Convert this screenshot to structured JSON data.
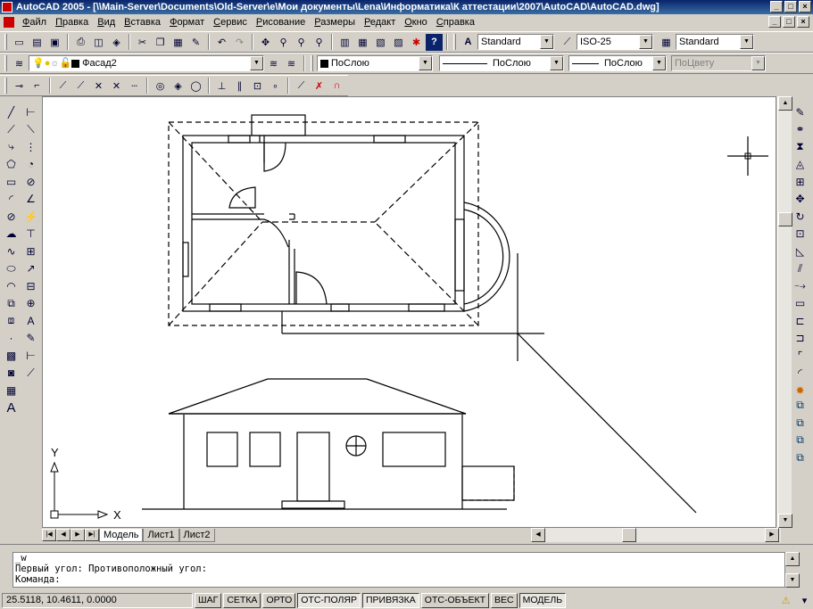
{
  "window": {
    "title": "AutoCAD 2005 - [\\\\Main-Server\\Documents\\Old-Server\\e\\Мои документы\\Lena\\Информатика\\К аттестации\\2007\\AutoCAD\\AutoCAD.dwg]",
    "minimize": "_",
    "maximize": "□",
    "close": "×"
  },
  "menu": [
    "Файл",
    "Правка",
    "Вид",
    "Вставка",
    "Формат",
    "Сервис",
    "Рисование",
    "Размеры",
    "Редакт",
    "Окно",
    "Справка"
  ],
  "styles_toolbar": {
    "text_style": "Standard",
    "dim_style": "ISO-25",
    "table_style": "Standard"
  },
  "layers_toolbar": {
    "current_layer": "Фасад2",
    "color": "ПоСлою",
    "linetype": "ПоСлою",
    "lineweight": "ПоСлою",
    "plot_style": "ПоЦвету"
  },
  "icons": {
    "standard": [
      "new-icon",
      "open-icon",
      "save-icon",
      "plot-icon",
      "preview-icon",
      "publish-icon",
      "cut-icon",
      "copy-icon",
      "paste-icon",
      "match-properties-icon",
      "undo-icon",
      "redo-icon",
      "pan-icon",
      "zoom-realtime-icon",
      "zoom-window-icon",
      "zoom-previous-icon",
      "properties-icon",
      "design-center-icon",
      "tool-palettes-icon",
      "sheet-set-icon",
      "markup-icon",
      "help-icon"
    ],
    "osnap": [
      "temp-track-icon",
      "from-icon",
      "endpoint-icon",
      "midpoint-icon",
      "intersection-icon",
      "apparent-intersection-icon",
      "extension-icon",
      "center-icon",
      "quadrant-icon",
      "tangent-icon",
      "perpendicular-icon",
      "parallel-icon",
      "insert-icon",
      "node-icon",
      "nearest-icon",
      "none-icon",
      "osnap-settings-icon"
    ],
    "draw": [
      "line-icon",
      "construction-line-icon",
      "polyline-icon",
      "polygon-icon",
      "rectangle-icon",
      "arc-icon",
      "circle-icon",
      "revision-cloud-icon",
      "spline-icon",
      "ellipse-icon",
      "ellipse-arc-icon",
      "insert-block-icon",
      "make-block-icon",
      "point-icon",
      "hatch-icon",
      "region-icon",
      "table-icon",
      "multiline-text-icon"
    ],
    "dimension": [
      "linear-dim-icon",
      "aligned-dim-icon",
      "ordinate-dim-icon",
      "radius-dim-icon",
      "diameter-dim-icon",
      "angular-dim-icon",
      "quick-dim-icon",
      "baseline-dim-icon",
      "continue-dim-icon",
      "qleader-icon",
      "tolerance-icon",
      "center-mark-icon",
      "dim-edit-icon",
      "dim-text-edit-icon",
      "dim-update-icon",
      "dim-style-icon",
      "dim-override-icon"
    ],
    "modify": [
      "erase-icon",
      "copy-object-icon",
      "mirror-icon",
      "offset-icon",
      "array-icon",
      "move-icon",
      "rotate-icon",
      "scale-icon",
      "stretch-icon",
      "trim-icon",
      "extend-icon",
      "break-at-point-icon",
      "break-icon",
      "join-icon",
      "chamfer-icon",
      "fillet-icon",
      "explode-icon"
    ],
    "draworder": [
      "bring-front-icon",
      "send-back-icon",
      "bring-above-icon",
      "send-under-icon"
    ]
  },
  "ucs": {
    "x_label": "X",
    "y_label": "Y"
  },
  "layout_tabs": [
    "Модель",
    "Лист1",
    "Лист2"
  ],
  "command_lines": [
    "_w",
    "Первый угол: Противоположный угол:",
    "Команда:"
  ],
  "status": {
    "coordinates": "25.5118, 10.4611, 0.0000",
    "toggles": [
      {
        "label": "ШАГ",
        "on": false
      },
      {
        "label": "СЕТКА",
        "on": false
      },
      {
        "label": "ОРТО",
        "on": false
      },
      {
        "label": "ОТС-ПОЛЯР",
        "on": true
      },
      {
        "label": "ПРИВЯЗКА",
        "on": true
      },
      {
        "label": "ОТС-ОБЪЕКТ",
        "on": false
      },
      {
        "label": "ВЕС",
        "on": false
      },
      {
        "label": "МОДЕЛЬ",
        "on": true
      }
    ]
  }
}
